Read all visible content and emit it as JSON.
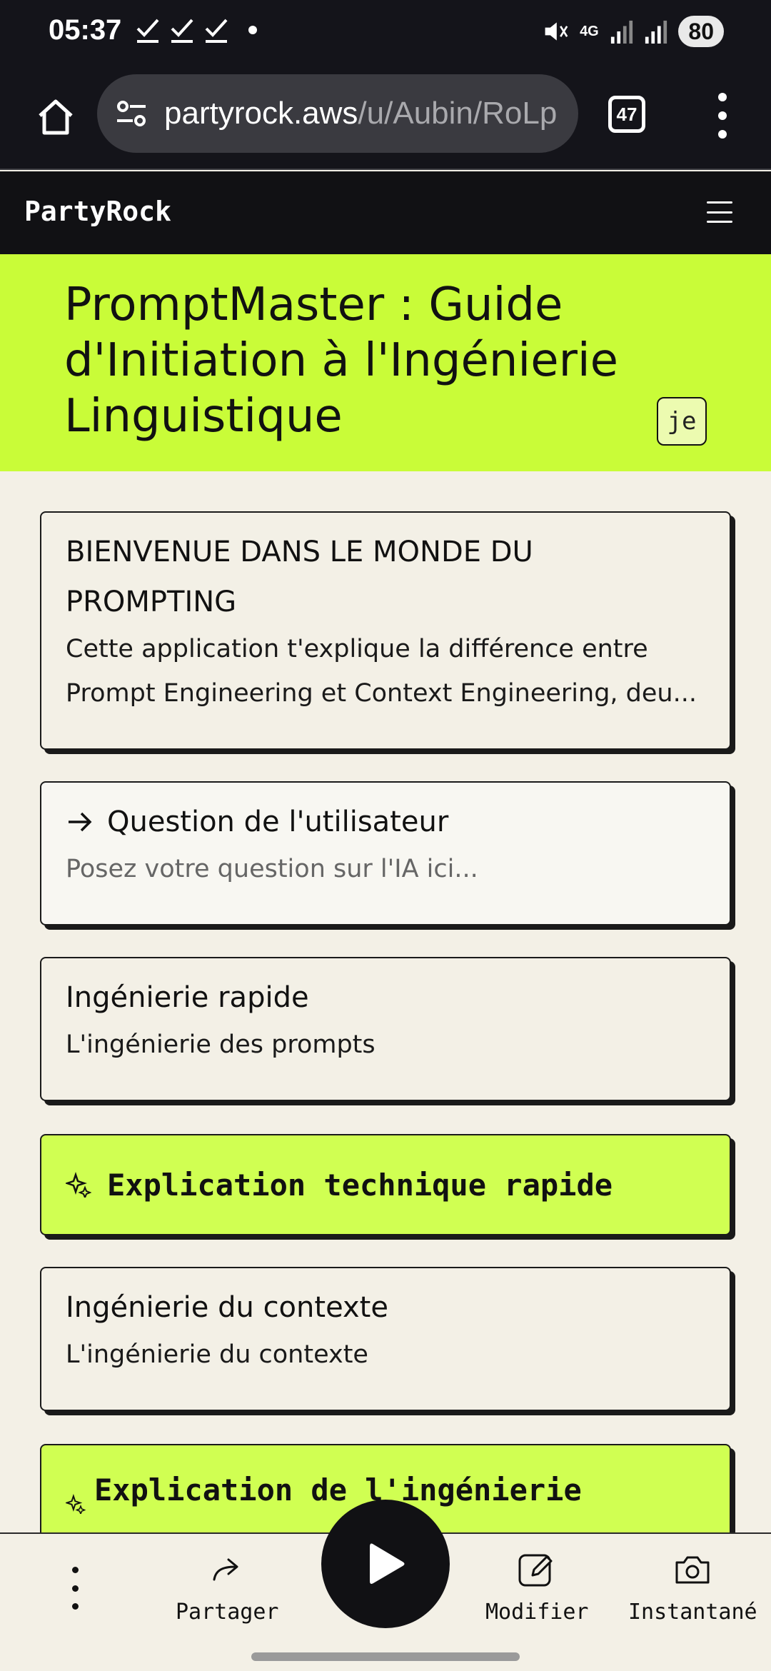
{
  "status_bar": {
    "time": "05:37",
    "network": "4G",
    "battery": "80"
  },
  "browser": {
    "url_host": "partyrock.aws",
    "url_path": "/u/Aubin/RoLp",
    "tab_count": "47"
  },
  "app": {
    "logo": "PartyRock",
    "title": "PromptMaster : Guide d'Initiation à l'Ingénierie Linguistique",
    "user_badge": "je"
  },
  "cards": {
    "welcome": {
      "heading": "BIENVENUE DANS LE MONDE DU PROMPTING",
      "text": "Cette application t'explique la différence entre Prompt Engineering et Context Engineering, deu..."
    },
    "question": {
      "label": "Question de l'utilisateur",
      "placeholder": "Posez votre question sur l'IA ici..."
    },
    "prompt_eng": {
      "heading": "Ingénierie rapide",
      "text": "L'ingénierie des prompts"
    },
    "quick_tech": {
      "label": "Explication technique rapide"
    },
    "context_eng": {
      "heading": "Ingénierie du contexte",
      "text": "L'ingénierie du contexte"
    },
    "context_expl": {
      "label": "Explication de l'ingénierie"
    }
  },
  "toolbar": {
    "share": "Partager",
    "edit": "Modifier",
    "snapshot": "Instantané"
  },
  "colors": {
    "accent": "#c9fc38",
    "dark": "#111114",
    "background": "#f3f0e6"
  }
}
